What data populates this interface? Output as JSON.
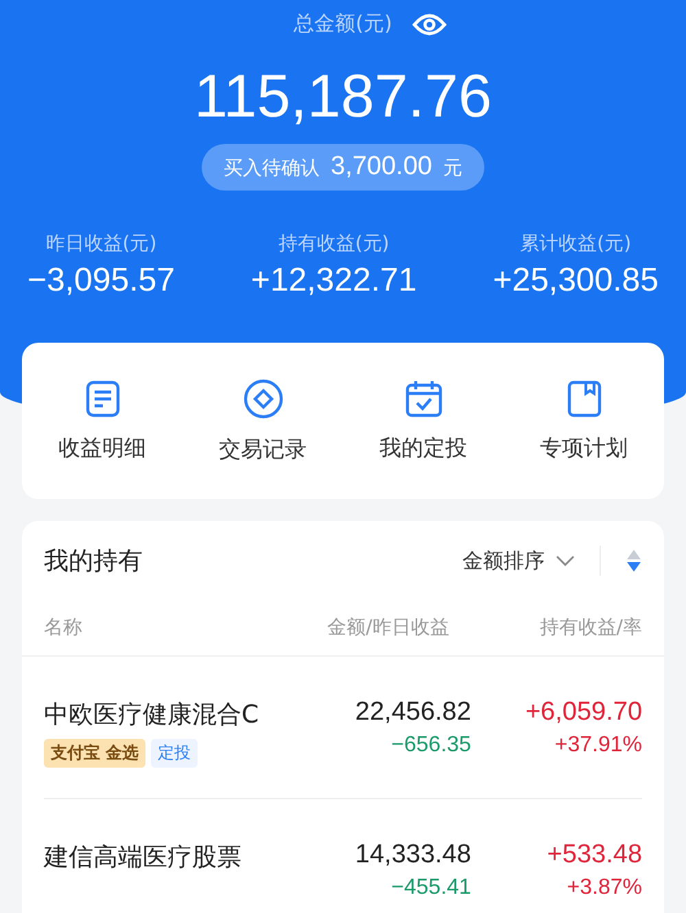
{
  "header": {
    "title": "总金额(元)",
    "total": "115,187.76",
    "pending": {
      "label": "买入待确认",
      "amount": "3,700.00",
      "unit": "元"
    }
  },
  "stats": [
    {
      "label": "昨日收益(元)",
      "value": "−3,095.57"
    },
    {
      "label": "持有收益(元)",
      "value": "+12,322.71"
    },
    {
      "label": "累计收益(元)",
      "value": "+25,300.85"
    }
  ],
  "actions": [
    {
      "kind": "doc",
      "label": "收益明细"
    },
    {
      "kind": "coin",
      "label": "交易记录"
    },
    {
      "kind": "calendar",
      "label": "我的定投"
    },
    {
      "kind": "book",
      "label": "专项计划"
    }
  ],
  "holdings": {
    "title": "我的持有",
    "sort": "金额排序",
    "columns": [
      "名称",
      "金额/昨日收益",
      "持有收益/率"
    ],
    "rows": [
      {
        "name": "中欧医疗健康混合C",
        "tags": [
          {
            "kind": "gold",
            "text": "支付宝 金选"
          },
          {
            "kind": "blue",
            "text": "定投"
          }
        ],
        "amount": "22,456.82",
        "daily": {
          "text": "−656.35",
          "color": "#1b9a6a"
        },
        "gain": {
          "text": "+6,059.70",
          "color": "#e0253a"
        },
        "rate": {
          "text": "+37.91%",
          "color": "#e0253a"
        }
      },
      {
        "name": "建信高端医疗股票",
        "tags": [],
        "amount": "14,333.48",
        "daily": {
          "text": "−455.41",
          "color": "#1b9a6a"
        },
        "gain": {
          "text": "+533.48",
          "color": "#e0253a"
        },
        "rate": {
          "text": "+3.87%",
          "color": "#e0253a"
        }
      }
    ]
  }
}
